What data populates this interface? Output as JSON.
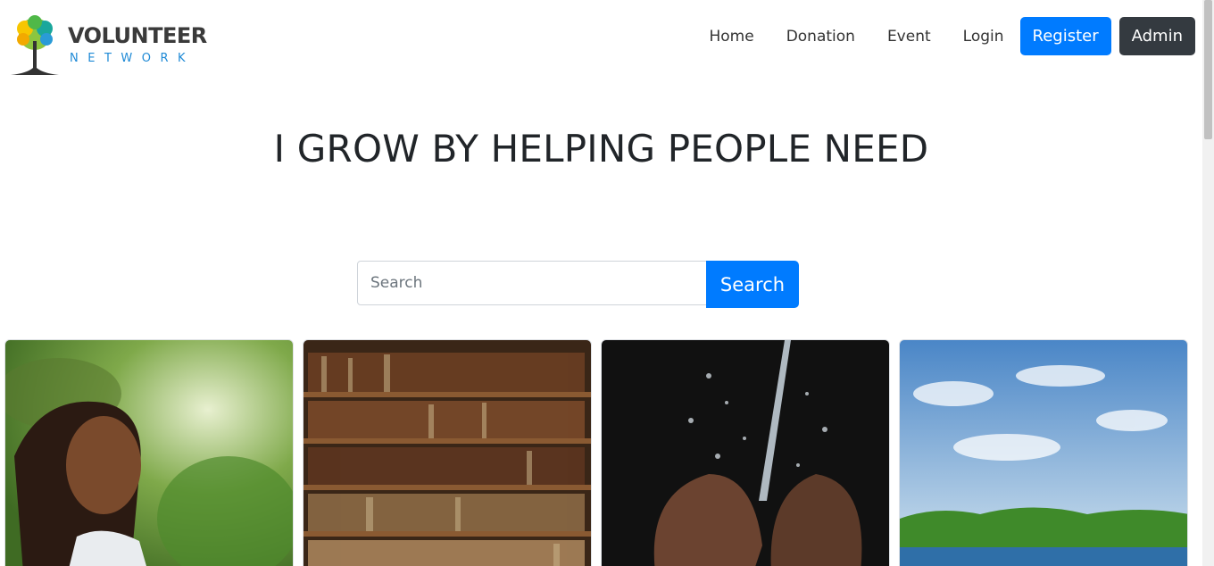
{
  "brand": {
    "title": "VOLUNTEER",
    "subtitle": "NETWORK"
  },
  "nav": {
    "links": [
      "Home",
      "Donation",
      "Event",
      "Login"
    ],
    "register_label": "Register",
    "admin_label": "Admin"
  },
  "hero": {
    "headline": "I GROW BY HELPING PEOPLE NEED"
  },
  "search": {
    "placeholder": "Search",
    "value": "",
    "button_label": "Search"
  },
  "cards": [
    {
      "image": "child-smiling-photo"
    },
    {
      "image": "bookshelf-photo"
    },
    {
      "image": "water-hands-photo"
    },
    {
      "image": "river-landscape-photo"
    }
  ],
  "colors": {
    "primary": "#007bff",
    "dark": "#343a40",
    "brand_blue": "#1f8ad6"
  }
}
